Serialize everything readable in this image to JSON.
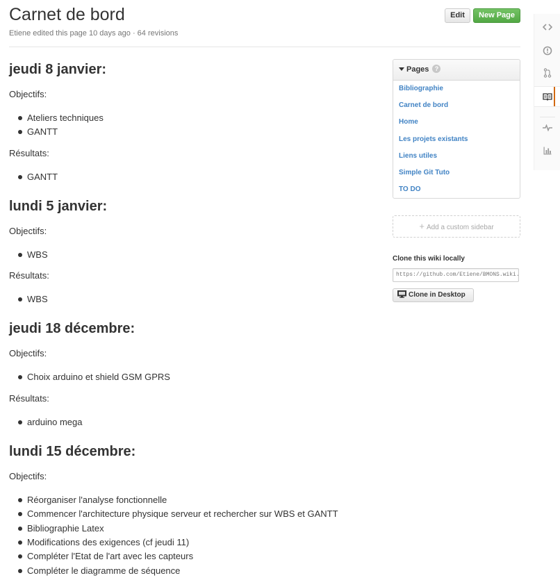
{
  "header": {
    "title": "Carnet de bord",
    "meta": "Etiene edited this page 10 days ago · 64 revisions",
    "edit_label": "Edit",
    "new_page_label": "New Page"
  },
  "sections": [
    {
      "heading": "jeudi 8 janvier:",
      "objectifs_label": "Objectifs:",
      "objectifs": [
        "Ateliers techniques",
        "GANTT"
      ],
      "resultats_label": "Résultats:",
      "resultats": [
        "GANTT"
      ]
    },
    {
      "heading": "lundi 5 janvier:",
      "objectifs_label": "Objectifs:",
      "objectifs": [
        "WBS"
      ],
      "resultats_label": "Résultats:",
      "resultats": [
        "WBS"
      ]
    },
    {
      "heading": "jeudi 18 décembre:",
      "objectifs_label": "Objectifs:",
      "objectifs": [
        "Choix arduino et shield GSM GPRS"
      ],
      "resultats_label": "Résultats:",
      "resultats": [
        "arduino mega"
      ]
    },
    {
      "heading": "lundi 15 décembre:",
      "objectifs_label": "Objectifs:",
      "objectifs": [
        "Réorganiser l'analyse fonctionnelle",
        "Commencer l'architecture physique serveur et rechercher sur WBS et GANTT",
        "Bibliographie Latex",
        "Modifications des exigences (cf jeudi 11)",
        "Compléter l'Etat de l'art avec les capteurs",
        "Compléter le diagramme de séquence"
      ]
    }
  ],
  "sidebar": {
    "pages_title": "Pages",
    "pages_help": "?",
    "pages": [
      "Bibliographie",
      "Carnet de bord",
      "Home",
      "Les projets existants",
      "Liens utiles",
      "Simple Git Tuto",
      "TO DO"
    ],
    "custom_sidebar_label": "Add a custom sidebar",
    "clone_label": "Clone this wiki locally",
    "clone_url": "https://github.com/Etiene/BMONS.wiki.git",
    "clone_desktop_label": "Clone in Desktop"
  },
  "rail": {
    "items": [
      "code-icon",
      "issue-icon",
      "pull-request-icon",
      "wiki-icon",
      "pulse-icon",
      "graphs-icon"
    ],
    "active": "wiki-icon"
  },
  "colors": {
    "link": "#4183c4",
    "new_page_button": "#60b44e",
    "active_rail_indicator": "#d26911"
  }
}
